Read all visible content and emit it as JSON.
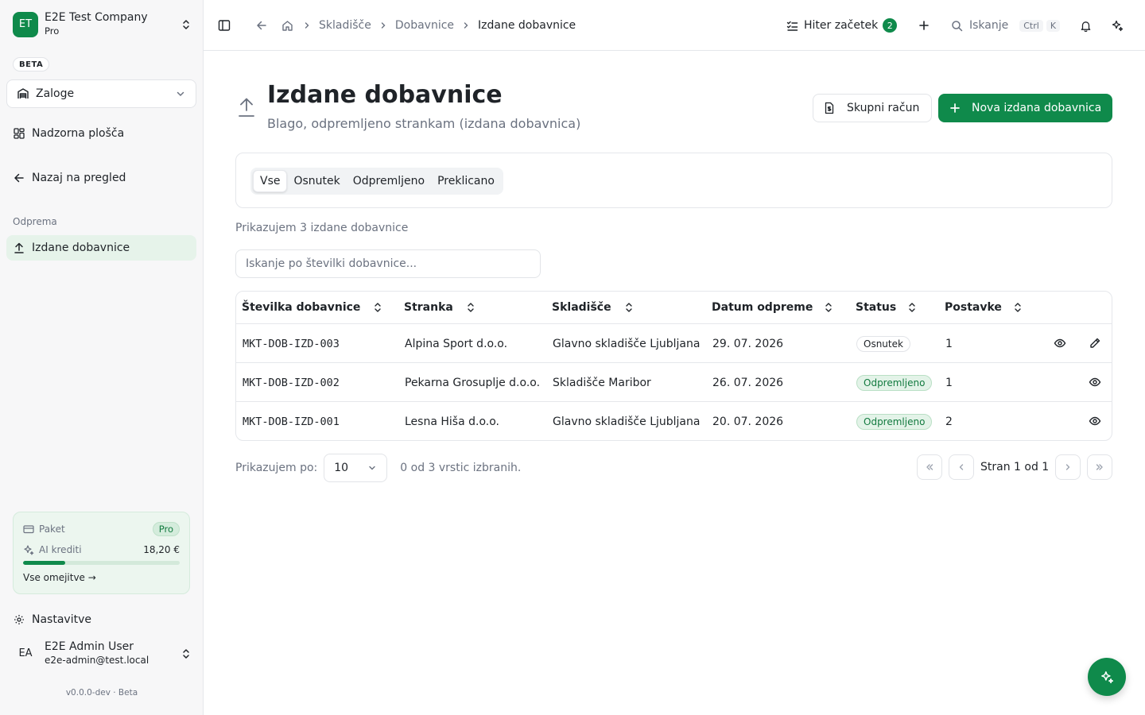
{
  "company": {
    "initials": "ET",
    "name": "E2E Test Company",
    "plan": "Pro"
  },
  "beta_label": "BETA",
  "module_select": {
    "value": "Zaloge"
  },
  "sidebar": {
    "dashboard": "Nadzorna plošča",
    "back": "Nazaj na pregled",
    "group_label": "Odprema",
    "active_item": "Izdane dobavnice",
    "settings": "Nastavitve"
  },
  "plan_card": {
    "plan_label": "Paket",
    "plan_badge": "Pro",
    "credits_label": "AI krediti",
    "credits_value": "18,20 €",
    "credits_progress": 0.27,
    "limits_link": "Vse omejitve →"
  },
  "user": {
    "initials": "EA",
    "name": "E2E Admin User",
    "email": "e2e-admin@test.local"
  },
  "version": "v0.0.0-dev · Beta",
  "breadcrumb": {
    "items": [
      "Skladišče",
      "Dobavnice"
    ],
    "current": "Izdane dobavnice"
  },
  "topbar": {
    "quick_start": "Hiter začetek",
    "quick_start_count": "2",
    "search_label": "Iskanje",
    "kbd_ctrl": "Ctrl",
    "kbd_k": "K"
  },
  "page": {
    "title": "Izdane dobavnice",
    "subtitle": "Blago, odpremljeno strankam (izdana dobavnica)",
    "btn_invoice": "Skupni račun",
    "btn_new": "Nova izdana dobavnica"
  },
  "tabs": [
    "Vse",
    "Osnutek",
    "Odpremljeno",
    "Preklicano"
  ],
  "list": {
    "showing": "Prikazujem 3 izdane dobavnice",
    "search_placeholder": "Iskanje po številki dobavnice..."
  },
  "table": {
    "headers": [
      "Številka dobavnice",
      "Stranka",
      "Skladišče",
      "Datum odpreme",
      "Status",
      "Postavke"
    ],
    "rows": [
      {
        "number": "MKT-DOB-IZD-003",
        "customer": "Alpina Sport d.o.o.",
        "warehouse": "Glavno skladišče Ljubljana",
        "date": "29. 07. 2026",
        "status": "Osnutek",
        "items": "1"
      },
      {
        "number": "MKT-DOB-IZD-002",
        "customer": "Pekarna Grosuplje d.o.o.",
        "warehouse": "Skladišče Maribor",
        "date": "26. 07. 2026",
        "status": "Odpremljeno",
        "items": "1"
      },
      {
        "number": "MKT-DOB-IZD-001",
        "customer": "Lesna Hiša d.o.o.",
        "warehouse": "Glavno skladišče Ljubljana",
        "date": "20. 07. 2026",
        "status": "Odpremljeno",
        "items": "2"
      }
    ]
  },
  "pagination": {
    "per_page_label": "Prikazujem po:",
    "per_page_value": "10",
    "selected_info": "0 od 3 vrstic izbranih.",
    "page_label": "Stran 1 od 1"
  },
  "colors": {
    "brand": "#0f8a4b",
    "active_bg": "#e6f3ea",
    "status_shipped_bg": "#e3f3e8"
  }
}
